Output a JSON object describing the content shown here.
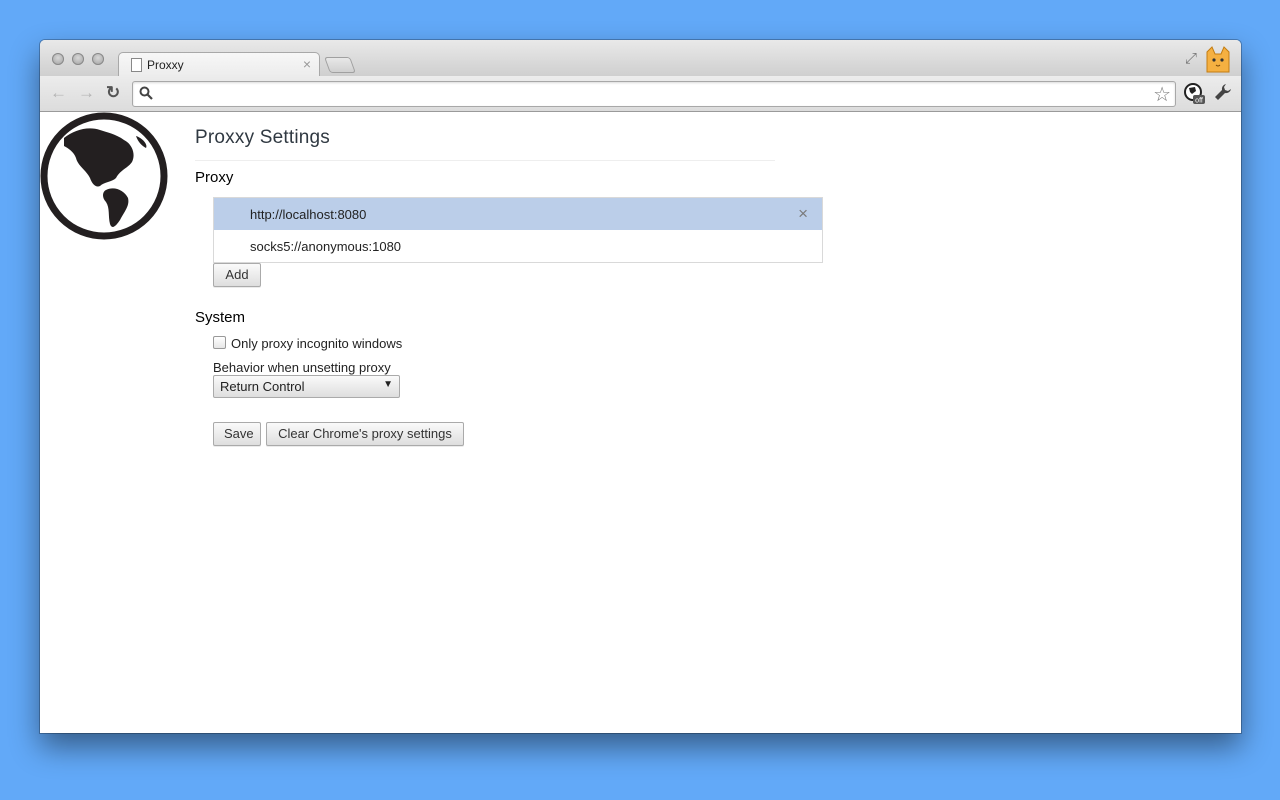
{
  "browser": {
    "tab_title": "Proxxy",
    "tab_close": "×",
    "omnibox_value": "",
    "extension_badge": "off"
  },
  "page": {
    "title": "Proxxy Settings",
    "proxy_section_title": "Proxy",
    "proxies": [
      {
        "url": "http://localhost:8080",
        "selected": true
      },
      {
        "url": "socks5://anonymous:1080",
        "selected": false
      }
    ],
    "row_delete": "×",
    "add_label": "Add",
    "system_section_title": "System",
    "incognito_label": "Only proxy incognito windows",
    "incognito_checked": false,
    "behavior_label": "Behavior when unsetting proxy",
    "behavior_value": "Return Control",
    "save_label": "Save",
    "clear_label": "Clear Chrome's proxy settings"
  },
  "icons": {
    "back": "back-arrow-icon",
    "forward": "forward-arrow-icon",
    "reload": "reload-icon",
    "search": "search-icon",
    "star": "star-icon",
    "globe": "globe-icon",
    "wrench": "wrench-icon",
    "cat": "cat-avatar-icon"
  },
  "colors": {
    "desktop": "#62a9f8",
    "selected_row": "#bbcee9",
    "title_text": "#303942"
  }
}
